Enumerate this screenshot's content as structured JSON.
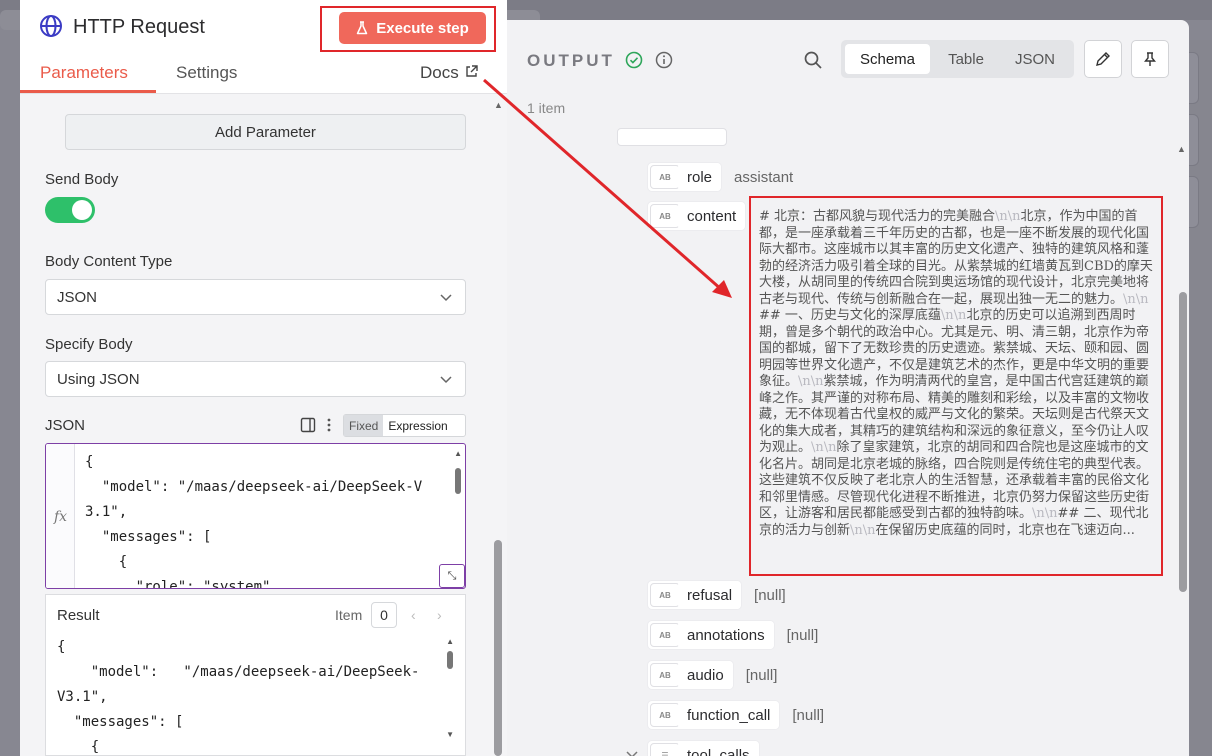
{
  "left_panel": {
    "node_title": "HTTP Request",
    "execute_label": "Execute step",
    "tabs": [
      {
        "label": "Parameters",
        "active": true
      },
      {
        "label": "Settings",
        "active": false
      }
    ],
    "docs_label": "Docs",
    "add_parameter_label": "Add Parameter",
    "send_body_label": "Send Body",
    "send_body_enabled": true,
    "body_content_type_label": "Body Content Type",
    "body_content_type_value": "JSON",
    "specify_body_label": "Specify Body",
    "specify_body_value": "Using JSON",
    "json_label": "JSON",
    "mode_fixed": "Fixed",
    "mode_expression": "Expression",
    "fx_label": "fx",
    "editor_lines": [
      "{",
      "  \"model\": \"/maas/deepseek-ai/DeepSeek-V",
      "3.1\",",
      "  \"messages\": [",
      "    {",
      "      \"role\": \"system\""
    ],
    "result": {
      "title": "Result",
      "item_label": "Item",
      "item_index": "0",
      "lines": [
        "{",
        "    \"model\":   \"/maas/deepseek-ai/DeepSeek-",
        "V3.1\",",
        "  \"messages\": [",
        "    {"
      ]
    }
  },
  "right_panel": {
    "output_label": "OUTPUT",
    "view_tabs": [
      {
        "label": "Schema",
        "active": true
      },
      {
        "label": "Table",
        "active": false
      },
      {
        "label": "JSON",
        "active": false
      }
    ],
    "item_count": "1 item",
    "type_badge": "AB",
    "fields": [
      {
        "key": "role",
        "value": "assistant"
      },
      {
        "key": "content",
        "value": ""
      },
      {
        "key": "refusal",
        "value": "[null]"
      },
      {
        "key": "annotations",
        "value": "[null]"
      },
      {
        "key": "audio",
        "value": "[null]"
      },
      {
        "key": "function_call",
        "value": "[null]"
      },
      {
        "key": "tool_calls",
        "value": ""
      }
    ],
    "content_segments": [
      {
        "t": "# 北京：古都风貌与现代活力的完美融合",
        "esc": false
      },
      {
        "t": "\\n\\n",
        "esc": true
      },
      {
        "t": "北京，作为中国的首都，是一座承载着三千年历史的古都，也是一座不断发展的现代化国际大都市。这座城市以其丰富的历史文化遗产、独特的建筑风格和蓬勃的经济活力吸引着全球的目光。从紫禁城的红墙黄瓦到CBD的摩天大楼，从胡同里的传统四合院到奥运场馆的现代设计，北京完美地将古老与现代、传统与创新融合在一起，展现出独一无二的魅力。",
        "esc": false
      },
      {
        "t": "\\n\\n",
        "esc": true
      },
      {
        "t": "## 一、历史与文化的深厚底蕴",
        "esc": false
      },
      {
        "t": "\\n\\n",
        "esc": true
      },
      {
        "t": "北京的历史可以追溯到西周时期，曾是多个朝代的政治中心。尤其是元、明、清三朝，北京作为帝国的都城，留下了无数珍贵的历史遗迹。紫禁城、天坛、颐和园、圆明园等世界文化遗产，不仅是建筑艺术的杰作，更是中华文明的重要象征。",
        "esc": false
      },
      {
        "t": "\\n\\n",
        "esc": true
      },
      {
        "t": "紫禁城，作为明清两代的皇宫，是中国古代宫廷建筑的巅峰之作。其严谨的对称布局、精美的雕刻和彩绘，以及丰富的文物收藏，无不体现着古代皇权的威严与文化的繁荣。天坛则是古代祭天文化的集大成者，其精巧的建筑结构和深远的象征意义，至今仍让人叹为观止。",
        "esc": false
      },
      {
        "t": "\\n\\n",
        "esc": true
      },
      {
        "t": "除了皇家建筑，北京的胡同和四合院也是这座城市的文化名片。胡同是北京老城的脉络，四合院则是传统住宅的典型代表。这些建筑不仅反映了老北京人的生活智慧，还承载着丰富的民俗文化和邻里情感。尽管现代化进程不断推进，北京仍努力保留这些历史街区，让游客和居民都能感受到古都的独特韵味。",
        "esc": false
      },
      {
        "t": "\\n\\n",
        "esc": true
      },
      {
        "t": "## 二、现代北京的活力与创新",
        "esc": false
      },
      {
        "t": "\\n\\n",
        "esc": true
      },
      {
        "t": "在保留历史底蕴的同时，北京也在飞速迈向...",
        "esc": false
      }
    ]
  }
}
